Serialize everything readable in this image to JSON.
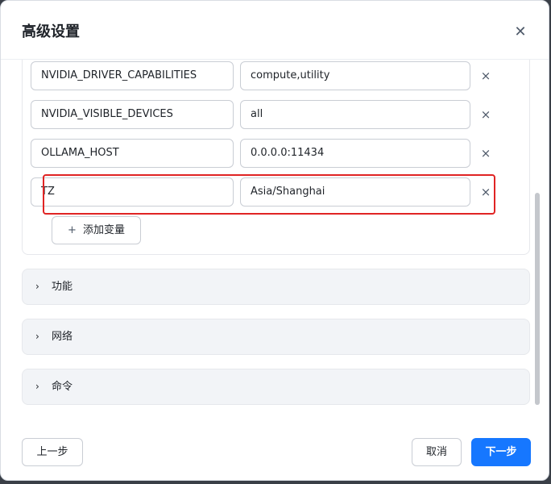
{
  "dialog": {
    "title": "高级设置",
    "close_icon": "close-icon"
  },
  "env_vars": [
    {
      "key": "NVIDIA_DRIVER_CAPABILITIES",
      "value": "compute,utility",
      "remove_icon": "×"
    },
    {
      "key": "NVIDIA_VISIBLE_DEVICES",
      "value": "all",
      "remove_icon": "×"
    },
    {
      "key": "OLLAMA_HOST",
      "value": "0.0.0.0:11434",
      "remove_icon": "×"
    },
    {
      "key": "TZ",
      "value": "Asia/Shanghai",
      "remove_icon": "×"
    }
  ],
  "add_variable_label": "添加变量",
  "sections": [
    {
      "label": "功能"
    },
    {
      "label": "网络"
    },
    {
      "label": "命令"
    }
  ],
  "footer": {
    "prev_label": "上一步",
    "cancel_label": "取消",
    "next_label": "下一步"
  },
  "colors": {
    "primary": "#1677ff",
    "highlight": "#e02424"
  }
}
